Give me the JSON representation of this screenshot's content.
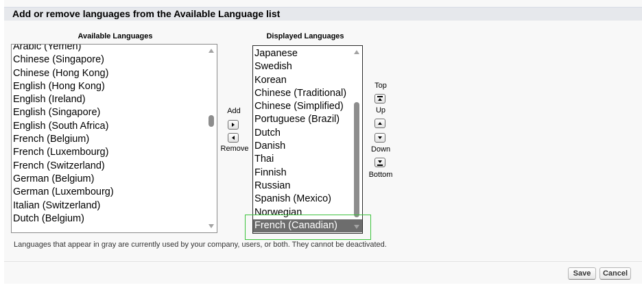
{
  "header": {
    "title": "Add or remove languages from the Available Language list"
  },
  "available": {
    "label": "Available Languages",
    "items": [
      "Arabic (Yemen)",
      "Chinese (Singapore)",
      "Chinese (Hong Kong)",
      "English (Hong Kong)",
      "English (Ireland)",
      "English (Singapore)",
      "English (South Africa)",
      "French (Belgium)",
      "French (Luxembourg)",
      "French (Switzerland)",
      "German (Belgium)",
      "German (Luxembourg)",
      "Italian (Switzerland)",
      "Dutch (Belgium)"
    ]
  },
  "transfer": {
    "add_label": "Add",
    "remove_label": "Remove"
  },
  "displayed": {
    "label": "Displayed Languages",
    "items": [
      "Japanese",
      "Swedish",
      "Korean",
      "Chinese (Traditional)",
      "Chinese (Simplified)",
      "Portuguese (Brazil)",
      "Dutch",
      "Danish",
      "Thai",
      "Finnish",
      "Russian",
      "Spanish (Mexico)",
      "Norwegian",
      "French (Canadian)"
    ],
    "selected": "French (Canadian)"
  },
  "ordering": {
    "top_label": "Top",
    "up_label": "Up",
    "down_label": "Down",
    "bottom_label": "Bottom"
  },
  "note": "Languages that appear in gray are currently used by your company, users, or both. They cannot be deactivated.",
  "actions": {
    "save_label": "Save",
    "cancel_label": "Cancel"
  },
  "colors": {
    "highlight": "#3dc33d",
    "selected_bg": "#6d6d6d",
    "header_bg": "#e6e8ec"
  }
}
